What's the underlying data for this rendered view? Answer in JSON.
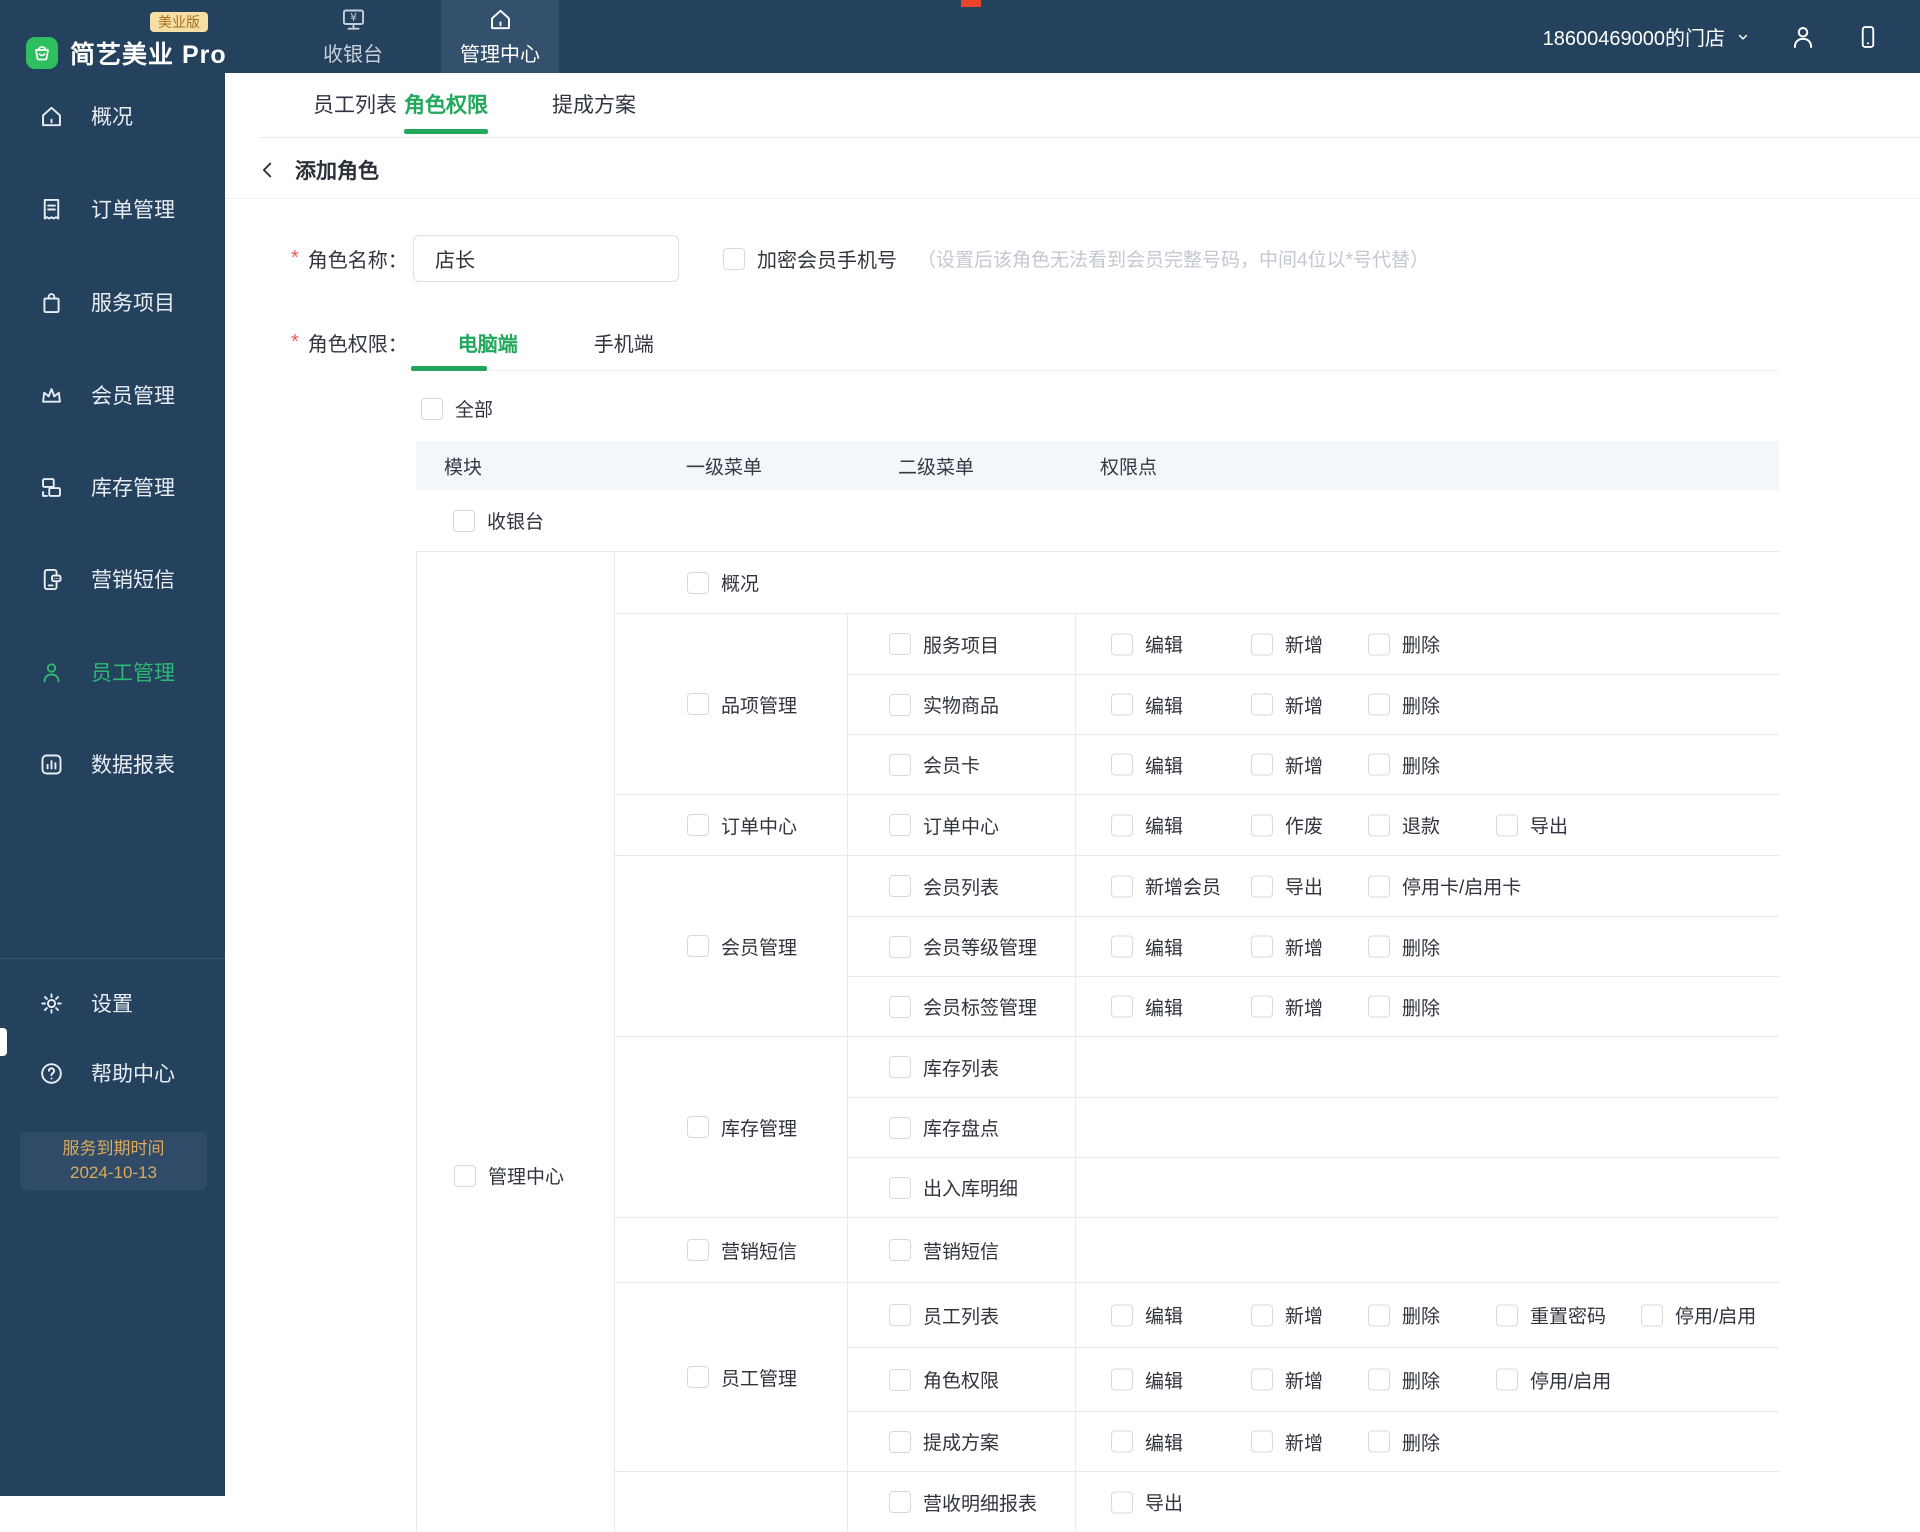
{
  "app": {
    "name": "简艺美业 Pro",
    "edition_badge": "美业版",
    "store_name": "18600469000的门店"
  },
  "topbar": {
    "tabs": [
      {
        "label": "收银台",
        "icon": "cashier-monitor-icon"
      },
      {
        "label": "管理中心",
        "icon": "home-icon",
        "active": true
      }
    ]
  },
  "sidebar": {
    "items": [
      {
        "label": "概况",
        "icon": "home-icon"
      },
      {
        "label": "订单管理",
        "icon": "order-icon"
      },
      {
        "label": "服务项目",
        "icon": "service-bag-icon"
      },
      {
        "label": "会员管理",
        "icon": "crown-icon"
      },
      {
        "label": "库存管理",
        "icon": "inventory-icon"
      },
      {
        "label": "营销短信",
        "icon": "sms-phone-icon"
      },
      {
        "label": "员工管理",
        "icon": "person-icon",
        "active": true
      },
      {
        "label": "数据报表",
        "icon": "bar-chart-icon"
      }
    ],
    "footer_items": [
      {
        "label": "设置",
        "icon": "gear-icon"
      },
      {
        "label": "帮助中心",
        "icon": "question-icon"
      }
    ],
    "expiry": {
      "line1": "服务到期时间",
      "line2": "2024-10-13"
    }
  },
  "page": {
    "tabs": [
      {
        "label": "员工列表"
      },
      {
        "label": "角色权限",
        "active": true
      },
      {
        "label": "提成方案"
      }
    ],
    "back_title": "添加角色",
    "form": {
      "required_mark": "*",
      "role_name_label": "角色名称：",
      "role_name_value": "店长",
      "encrypt_label": "加密会员手机号",
      "encrypt_hint": "（设置后该角色无法看到会员完整号码，中间4位以*号代替）",
      "role_perm_label": "角色权限：",
      "perm_tabs": [
        {
          "label": "电脑端",
          "active": true
        },
        {
          "label": "手机端"
        }
      ],
      "select_all_label": "全部"
    },
    "table": {
      "headers": [
        "模块",
        "一级菜单",
        "二级菜单",
        "权限点"
      ],
      "cashier_module": {
        "label": "收银台"
      },
      "center_module": {
        "label": "管理中心",
        "groups": [
          {
            "label": "概况",
            "rows": []
          },
          {
            "label": "品项管理",
            "rows": [
              {
                "label": "服务项目",
                "perms": [
                  "编辑",
                  "新增",
                  "删除"
                ]
              },
              {
                "label": "实物商品",
                "perms": [
                  "编辑",
                  "新增",
                  "删除"
                ]
              },
              {
                "label": "会员卡",
                "perms": [
                  "编辑",
                  "新增",
                  "删除"
                ]
              }
            ]
          },
          {
            "label": "订单中心",
            "rows": [
              {
                "label": "订单中心",
                "perms": [
                  "编辑",
                  "作废",
                  "退款",
                  "导出"
                ]
              }
            ]
          },
          {
            "label": "会员管理",
            "rows": [
              {
                "label": "会员列表",
                "perms": [
                  "新增会员",
                  "导出",
                  "停用卡/启用卡"
                ]
              },
              {
                "label": "会员等级管理",
                "perms": [
                  "编辑",
                  "新增",
                  "删除"
                ]
              },
              {
                "label": "会员标签管理",
                "perms": [
                  "编辑",
                  "新增",
                  "删除"
                ]
              }
            ]
          },
          {
            "label": "库存管理",
            "rows": [
              {
                "label": "库存列表",
                "perms": []
              },
              {
                "label": "库存盘点",
                "perms": []
              },
              {
                "label": "出入库明细",
                "perms": []
              }
            ]
          },
          {
            "label": "营销短信",
            "rows": [
              {
                "label": "营销短信",
                "perms": []
              }
            ]
          },
          {
            "label": "员工管理",
            "rows": [
              {
                "label": "员工列表",
                "perms": [
                  "编辑",
                  "新增",
                  "删除",
                  "重置密码",
                  "停用/启用"
                ]
              },
              {
                "label": "角色权限",
                "perms": [
                  "编辑",
                  "新增",
                  "删除",
                  "停用/启用"
                ]
              },
              {
                "label": "提成方案",
                "perms": [
                  "编辑",
                  "新增",
                  "删除"
                ]
              }
            ]
          },
          {
            "label": "",
            "rows": [
              {
                "label": "营收明细报表",
                "perms": [
                  "导出"
                ]
              }
            ]
          }
        ]
      }
    }
  },
  "colors": {
    "navy": "#24415e",
    "navy_active_tab": "#33506c",
    "accent_green": "#21a85c",
    "sidebar_active_green": "#2eb873",
    "logo_green": "#2ec05f",
    "badge_bg": "#f6dfa5",
    "badge_text": "#a5701f",
    "expiry_gold": "#dcab5c",
    "table_line": "#e6ebf2",
    "header_bg": "#f4f7fa",
    "hint_gray": "#c3c8d1",
    "required_red": "#f25a5a"
  }
}
